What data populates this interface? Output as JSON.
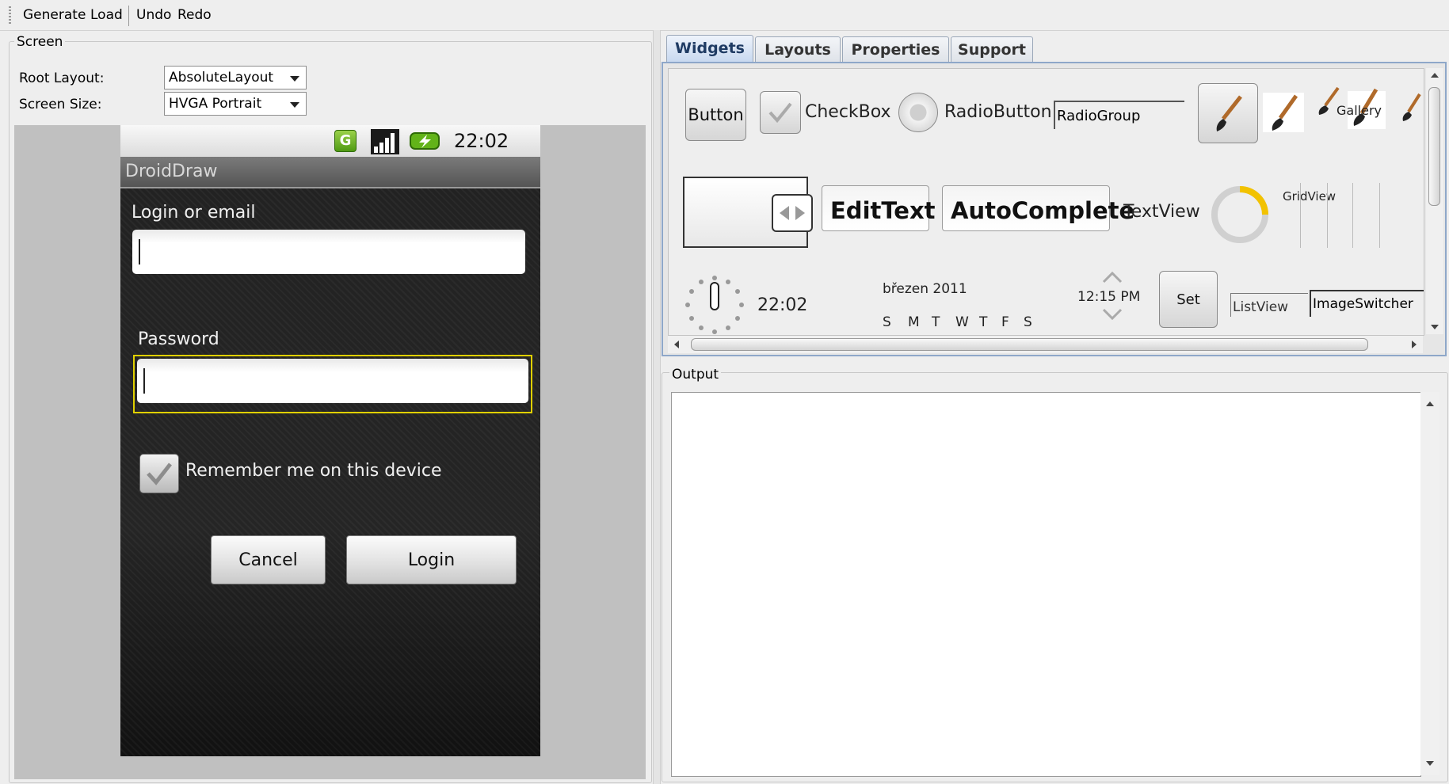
{
  "toolbar": {
    "generate": "Generate",
    "load": "Load",
    "undo": "Undo",
    "redo": "Redo"
  },
  "screen": {
    "title": "Screen",
    "root_layout_label": "Root Layout:",
    "root_layout_value": "AbsoluteLayout",
    "screen_size_label": "Screen Size:",
    "screen_size_value": "HVGA Portrait"
  },
  "phone": {
    "status_time": "22:02",
    "app_title": "DroidDraw",
    "login_label": "Login or email",
    "password_label": "Password",
    "remember_label": "Remember me on this device",
    "cancel_label": "Cancel",
    "login_button_label": "Login"
  },
  "tabs": [
    "Widgets",
    "Layouts",
    "Properties",
    "Support"
  ],
  "widgets": {
    "button": "Button",
    "checkbox": "CheckBox",
    "radiobutton": "RadioButton",
    "radiogroup": "RadioGroup",
    "gallery": "Gallery",
    "edittext": "EditText",
    "autocomplete": "AutoComplete",
    "textview": "TextView",
    "gridview": "GridView",
    "digital_clock": "22:02",
    "calendar_month": "březen 2011",
    "calendar_days": [
      "S",
      "M",
      "T",
      "W",
      "T",
      "F",
      "S"
    ],
    "timepicker": "12:15 PM",
    "set": "Set",
    "listview": "ListView",
    "imageswitcher": "ImageSwitcher"
  },
  "output": {
    "title": "Output"
  },
  "colors": {
    "tab_active": "#1f3b63",
    "focus_border": "#e0d000",
    "progress": "#f2c200"
  }
}
